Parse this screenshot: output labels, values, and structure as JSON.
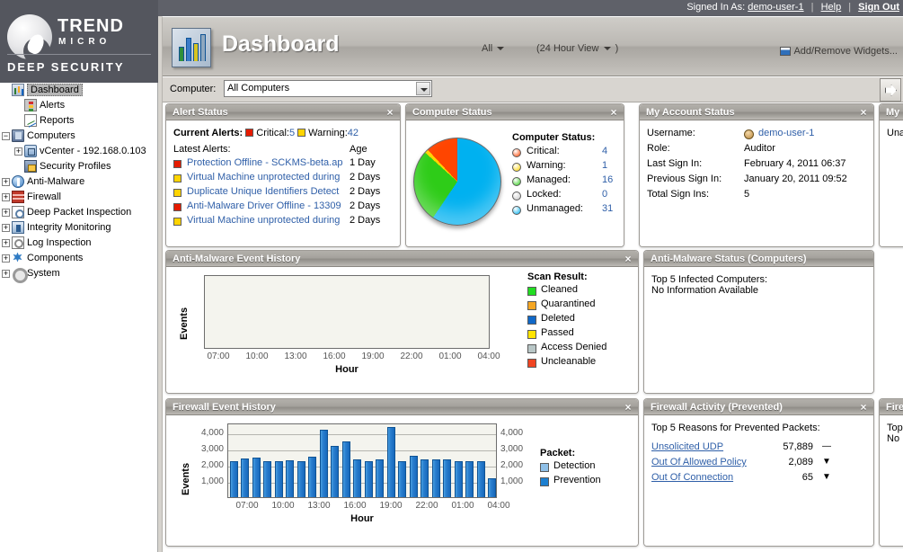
{
  "topbar": {
    "signed_in_label": "Signed In As:",
    "username": "demo-user-1",
    "help": "Help",
    "signout": "Sign Out"
  },
  "brand": {
    "trend": "TREND",
    "micro": "MICRO",
    "product": "DEEP SECURITY"
  },
  "sidebar": {
    "items": [
      {
        "label": "Dashboard",
        "icon": "dashboard-icon",
        "indent": 0,
        "expander": "none",
        "selected": true
      },
      {
        "label": "Alerts",
        "icon": "alerts-icon",
        "indent": 1,
        "expander": "none",
        "selected": false
      },
      {
        "label": "Reports",
        "icon": "reports-icon",
        "indent": 1,
        "expander": "none",
        "selected": false
      },
      {
        "label": "Computers",
        "icon": "computers-icon",
        "indent": 0,
        "expander": "minus",
        "selected": false
      },
      {
        "label": "vCenter - 192.168.0.103",
        "icon": "vcenter-icon",
        "indent": 1,
        "expander": "plus",
        "selected": false
      },
      {
        "label": "Security Profiles",
        "icon": "security-profiles-icon",
        "indent": 1,
        "expander": "none",
        "selected": false
      },
      {
        "label": "Anti-Malware",
        "icon": "anti-malware-icon",
        "indent": 0,
        "expander": "plus",
        "selected": false
      },
      {
        "label": "Firewall",
        "icon": "firewall-icon",
        "indent": 0,
        "expander": "plus",
        "selected": false
      },
      {
        "label": "Deep Packet Inspection",
        "icon": "dpi-icon",
        "indent": 0,
        "expander": "plus",
        "selected": false
      },
      {
        "label": "Integrity Monitoring",
        "icon": "integrity-icon",
        "indent": 0,
        "expander": "plus",
        "selected": false
      },
      {
        "label": "Log Inspection",
        "icon": "log-inspection-icon",
        "indent": 0,
        "expander": "plus",
        "selected": false
      },
      {
        "label": "Components",
        "icon": "components-icon",
        "indent": 0,
        "expander": "plus",
        "selected": false
      },
      {
        "label": "System",
        "icon": "system-icon",
        "indent": 0,
        "expander": "plus",
        "selected": false
      }
    ]
  },
  "page": {
    "title": "Dashboard",
    "scope": "All",
    "view": "(24 Hour View",
    "view_close": ")",
    "add_remove": "Add/Remove Widgets...",
    "configuration": "Configuration"
  },
  "filter": {
    "label": "Computer:",
    "value": "All Computers"
  },
  "widgets": {
    "alert_status": {
      "title": "Alert Status",
      "current_label": "Current Alerts:",
      "critical_label": "Critical:",
      "critical_count": "5",
      "warning_label": "Warning:",
      "warning_count": "42",
      "latest_label": "Latest Alerts:",
      "age_label": "Age",
      "rows": [
        {
          "severity": "critical",
          "text": "Protection Offline - SCKMS-beta.ap",
          "age": "1 Day"
        },
        {
          "severity": "warning",
          "text": "Virtual Machine unprotected during",
          "age": "2 Days"
        },
        {
          "severity": "warning",
          "text": "Duplicate Unique Identifiers Detect",
          "age": "2 Days"
        },
        {
          "severity": "critical",
          "text": "Anti-Malware Driver Offline - 13309",
          "age": "2 Days"
        },
        {
          "severity": "warning",
          "text": "Virtual Machine unprotected during",
          "age": "2 Days"
        }
      ]
    },
    "computer_status": {
      "title": "Computer Status",
      "legend_title": "Computer Status:",
      "rows": [
        {
          "label": "Critical:",
          "value": "4",
          "color": "#ff4500"
        },
        {
          "label": "Warning:",
          "value": "1",
          "color": "#ffd400"
        },
        {
          "label": "Managed:",
          "value": "16",
          "color": "#2ecc18"
        },
        {
          "label": "Locked:",
          "value": "0",
          "color": "#c8c8c8"
        },
        {
          "label": "Unmanaged:",
          "value": "31",
          "color": "#00b1f0"
        }
      ]
    },
    "my_account_status": {
      "title": "My Account Status",
      "rows": [
        {
          "label": "Username:",
          "value": "demo-user-1",
          "link": true,
          "icon": true
        },
        {
          "label": "Role:",
          "value": "Auditor",
          "link": false,
          "icon": false
        },
        {
          "label": "Last Sign In:",
          "value": "February 4, 2011 06:37",
          "link": false,
          "icon": false
        },
        {
          "label": "Previous Sign In:",
          "value": "January 20, 2011 09:52",
          "link": false,
          "icon": false
        },
        {
          "label": "Total Sign Ins:",
          "value": "5",
          "link": false,
          "icon": false
        }
      ]
    },
    "my_cut": {
      "title": "My",
      "text": "Unal"
    },
    "anti_malware_event_history": {
      "title": "Anti-Malware Event History"
    },
    "anti_malware_status": {
      "title": "Anti-Malware Status (Computers)",
      "subtitle": "Top 5 Infected Computers:",
      "message": "No Information Available"
    },
    "firewall_event_history": {
      "title": "Firewall Event History"
    },
    "firewall_activity_prevented": {
      "title": "Firewall Activity (Prevented)",
      "subtitle": "Top 5 Reasons for Prevented Packets:",
      "rows": [
        {
          "name": "Unsolicited UDP",
          "value": "57,889",
          "trend": "flat"
        },
        {
          "name": "Out Of Allowed Policy",
          "value": "2,089",
          "trend": "down"
        },
        {
          "name": "Out Of Connection",
          "value": "65",
          "trend": "down"
        }
      ]
    },
    "firewall_cut": {
      "title": "Fire",
      "subtitle": "Top",
      "message": "No I"
    }
  },
  "chart_data": [
    {
      "type": "bar",
      "title": "Anti-Malware Event History",
      "xlabel": "Hour",
      "ylabel": "Events",
      "categories": [
        "07:00",
        "10:00",
        "13:00",
        "16:00",
        "19:00",
        "22:00",
        "01:00",
        "04:00"
      ],
      "values": [],
      "ylim": [
        0,
        0
      ],
      "grid": false,
      "legend_position": "right",
      "legend_title": "Scan Result:",
      "legend": [
        {
          "name": "Cleaned",
          "color": "#22dd22"
        },
        {
          "name": "Quarantined",
          "color": "#f5a623"
        },
        {
          "name": "Deleted",
          "color": "#1068c8"
        },
        {
          "name": "Passed",
          "color": "#ffe400"
        },
        {
          "name": "Access Denied",
          "color": "#b8c6c6"
        },
        {
          "name": "Uncleanable",
          "color": "#f04422"
        }
      ]
    },
    {
      "type": "bar",
      "title": "Firewall Event History",
      "xlabel": "Hour",
      "ylabel": "Events",
      "categories": [
        "07:00",
        "10:00",
        "13:00",
        "16:00",
        "19:00",
        "22:00",
        "01:00",
        "04:00"
      ],
      "ytick_labels": [
        "1,000",
        "2,000",
        "3,000",
        "4,000"
      ],
      "ylim": [
        0,
        4600
      ],
      "grid": true,
      "legend_position": "right",
      "legend_title": "Packet:",
      "legend": [
        {
          "name": "Detection",
          "color": "#8fc0e8"
        },
        {
          "name": "Prevention",
          "color": "#1c7fd0"
        }
      ],
      "series": [
        {
          "name": "Prevention",
          "values": [
            2230,
            2380,
            2430,
            2230,
            2240,
            2290,
            2230,
            2500,
            4180,
            3140,
            3450,
            2300,
            2230,
            2300,
            4310,
            2230,
            2560,
            2300,
            2310,
            2300,
            2230,
            2230,
            2230,
            1140
          ]
        }
      ]
    }
  ]
}
